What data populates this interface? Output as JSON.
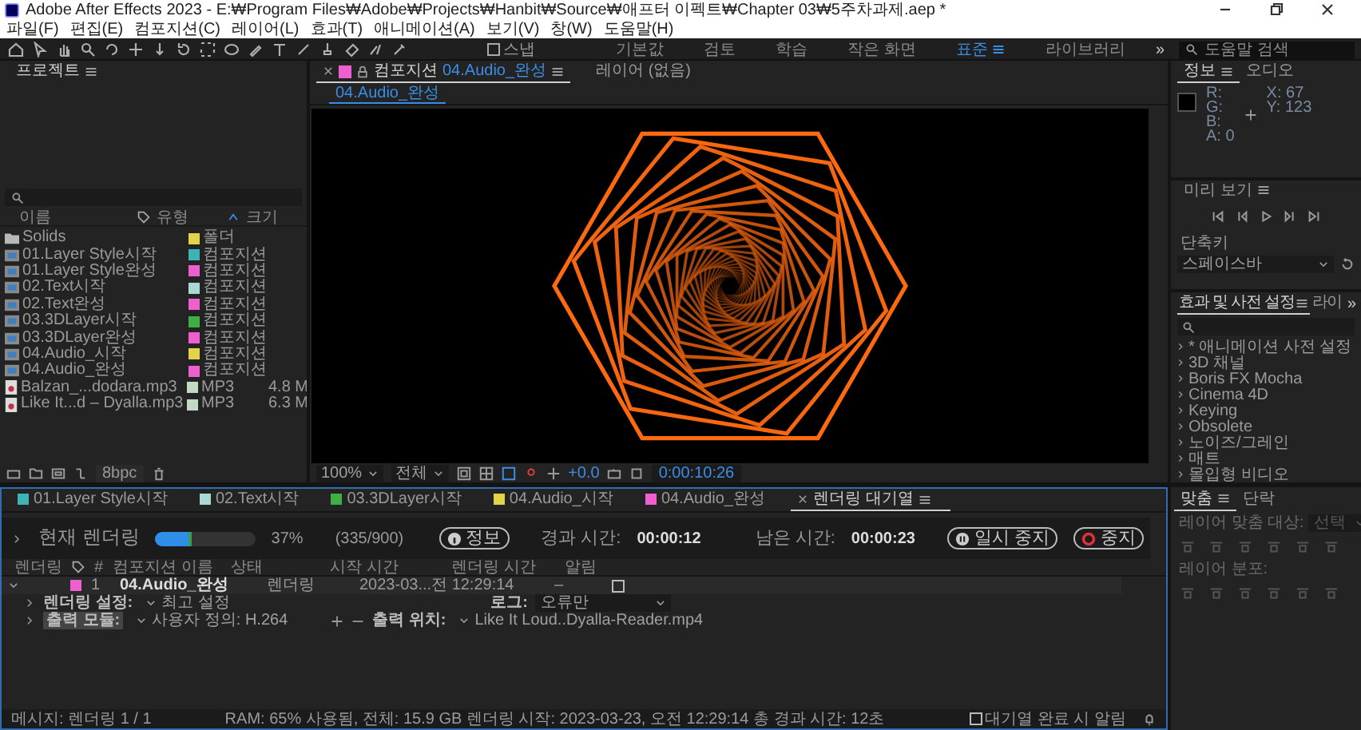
{
  "window": {
    "title": "Adobe After Effects 2023 - E:₩Program Files₩Adobe₩Projects₩Hanbit₩Source₩애프터 이펙트₩Chapter 03₩5주차과제.aep *"
  },
  "menu": [
    "파일(F)",
    "편집(E)",
    "컴포지션(C)",
    "레이어(L)",
    "효과(T)",
    "애니메이션(A)",
    "보기(V)",
    "창(W)",
    "도움말(H)"
  ],
  "toolbar": {
    "snap": {
      "label": "스냅",
      "checked": false
    },
    "workspaces": [
      {
        "label": "기본값",
        "selected": false
      },
      {
        "label": "검토",
        "selected": false
      },
      {
        "label": "학습",
        "selected": false
      },
      {
        "label": "작은 화면",
        "selected": false
      },
      {
        "label": "표준",
        "selected": true
      },
      {
        "label": "라이브러리",
        "selected": false
      }
    ],
    "overflow": "»",
    "search": {
      "placeholder": "도움말 검색"
    }
  },
  "project": {
    "tab": "프로젝트",
    "columns": [
      "이름",
      "유형",
      "크기"
    ],
    "bit_depth": "8bpc",
    "rows": [
      {
        "kind": "folder",
        "name": "Solids",
        "color": "#e3d34a",
        "type": "폴더"
      },
      {
        "kind": "comp",
        "name": "01.Layer Style시작",
        "color": "#3db3b3",
        "type": "컴포지션"
      },
      {
        "kind": "comp",
        "name": "01.Layer Style완성",
        "color": "#ee5fd0",
        "type": "컴포지션"
      },
      {
        "kind": "comp",
        "name": "02.Text시작",
        "color": "#a9d9d2",
        "type": "컴포지션"
      },
      {
        "kind": "comp",
        "name": "02.Text완성",
        "color": "#ee5fd0",
        "type": "컴포지션"
      },
      {
        "kind": "comp",
        "name": "03.3DLayer시작",
        "color": "#3fae45",
        "type": "컴포지션"
      },
      {
        "kind": "comp",
        "name": "03.3DLayer완성",
        "color": "#ee5fd0",
        "type": "컴포지션"
      },
      {
        "kind": "comp",
        "name": "04.Audio_시작",
        "color": "#e3d34a",
        "type": "컴포지션"
      },
      {
        "kind": "comp",
        "name": "04.Audio_완성",
        "color": "#ee5fd0",
        "type": "컴포지션"
      },
      {
        "kind": "audio",
        "name": "Balzan_...dodara.mp3",
        "color": "#c3d9c5",
        "type": "MP3",
        "size": "4.8 M"
      },
      {
        "kind": "audio",
        "name": "Like It...d – Dyalla.mp3",
        "color": "#c3d9c5",
        "type": "MP3",
        "size": "6.3 M"
      }
    ]
  },
  "viewer": {
    "tabs": [
      {
        "kind": "comp",
        "label": "컴포지션",
        "comp": "04.Audio_완성",
        "selected": true
      },
      {
        "kind": "layer",
        "label": "레이어 (없음)",
        "selected": false
      }
    ],
    "subtab": "04.Audio_완성",
    "zoom": "100%",
    "resolution": "전체",
    "exposure": "+0.0",
    "timecode": "0:00:10:26"
  },
  "info": {
    "tabs": [
      {
        "label": "정보",
        "selected": true
      },
      {
        "label": "오디오",
        "selected": false
      }
    ],
    "channels": [
      {
        "label": "R:"
      },
      {
        "label": "G:"
      },
      {
        "label": "B:"
      },
      {
        "label": "A:",
        "value": "0"
      }
    ],
    "x": "X: 67",
    "y": "Y: 123"
  },
  "preview": {
    "title": "미리 보기",
    "shortcut_label": "단축키",
    "shortcut": "스페이스바"
  },
  "effects": {
    "tabs": [
      {
        "label": "효과 및 사전 설정",
        "selected": true
      },
      {
        "label": "라이",
        "selected": false
      }
    ],
    "overflow": "»",
    "items": [
      "* 애니메이션 사전 설정",
      "3D 채널",
      "Boris FX Mocha",
      "Cinema 4D",
      "Keying",
      "Obsolete",
      "노이즈/그레인",
      "매트",
      "몰입형 비디오"
    ]
  },
  "timeline_tabs": [
    {
      "kind": "comp",
      "label": "01.Layer Style시작",
      "color": "#3db3b3",
      "selected": false
    },
    {
      "kind": "comp",
      "label": "02.Text시작",
      "color": "#a9d9d2",
      "selected": false
    },
    {
      "kind": "comp",
      "label": "03.3DLayer시작",
      "color": "#3fae45",
      "selected": false
    },
    {
      "kind": "comp",
      "label": "04.Audio_시작",
      "color": "#e3d34a",
      "selected": false
    },
    {
      "kind": "comp",
      "label": "04.Audio_완성",
      "color": "#ee5fd0",
      "selected": false
    },
    {
      "kind": "queue",
      "label": "렌더링 대기열",
      "selected": true
    }
  ],
  "render": {
    "current_label": "현재 렌더링",
    "level": 0.37,
    "percent": "37%",
    "frames": "(335/900)",
    "info_button": "정보",
    "elapsed_label": "경과 시간:",
    "elapsed": "00:00:12",
    "remaining_label": "남은 시간:",
    "remaining": "00:00:23",
    "pause_button": "일시 중지",
    "stop_button": "중지",
    "columns": [
      "렌더링",
      "#",
      "컴포지션 이름",
      "상태",
      "시작 시간",
      "렌더링 시간",
      "알림"
    ],
    "items": [
      {
        "expanded": true,
        "color": "#ee5fd0",
        "index": "1",
        "name": "04.Audio_완성",
        "status": "렌더링",
        "start": "2023-03...전 12:29:14",
        "render_time": "–",
        "notify": false,
        "settings_label": "렌더링 설정:",
        "settings": "최고 설정",
        "log_label": "로그:",
        "log": "오류만",
        "output_label": "출력 모듈:",
        "output": "사용자 정의: H.264",
        "dest_label": "출력 위치:",
        "dest": "Like It Loud..Dyalla-Reader.mp4"
      }
    ],
    "message": "메시지: 렌더링 1 / 1",
    "stats": "RAM: 65% 사용됨, 전체: 15.9 GB 렌더링 시작: 2023-03-23, 오전 12:29:14 총 경과 시간: 12초",
    "notify_label": "대기열 완료 시 알림",
    "notify_done": false
  },
  "align": {
    "tabs": [
      {
        "label": "맞춤",
        "selected": true
      },
      {
        "label": "단락",
        "selected": false
      }
    ],
    "align_to_label": "레이어 맞춤 대상:",
    "align_to": "선택",
    "distribute_label": "레이어 분포:"
  }
}
